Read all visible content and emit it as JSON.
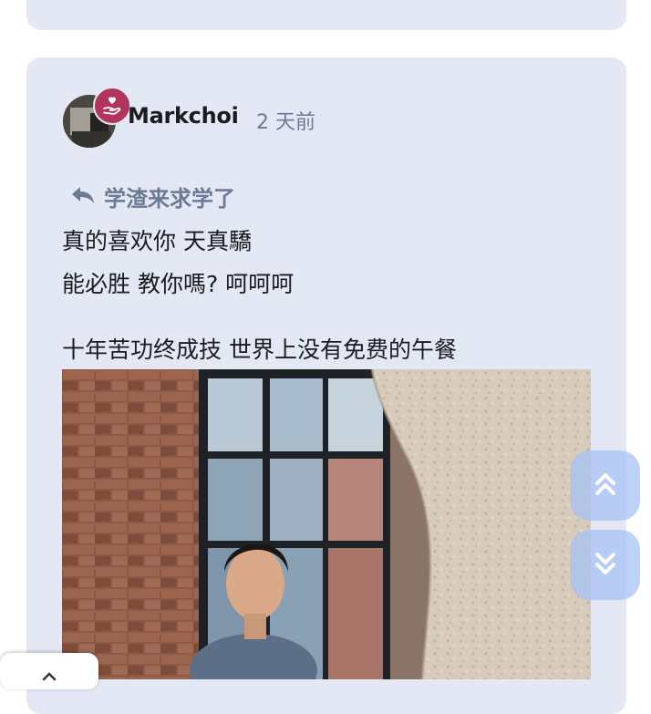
{
  "post": {
    "username": "Markchoi",
    "timestamp": "2 天前",
    "reply_to": "学渣来求学了",
    "lines": [
      "真的喜欢你 天真驕",
      "能必胜 教你嗎? 呵呵呵",
      "十年苦功终成技 世界上没有免费的午餐"
    ],
    "badge_icon": "heart-hand-icon"
  },
  "floating": {
    "up_icon": "double-chevron-up-icon",
    "down_icon": "double-chevron-down-icon"
  },
  "colors": {
    "card_bg": "#e3e8f4",
    "accent_muted": "#6d7a95",
    "badge": "#b1345a",
    "fab": "#a7c3f5"
  }
}
